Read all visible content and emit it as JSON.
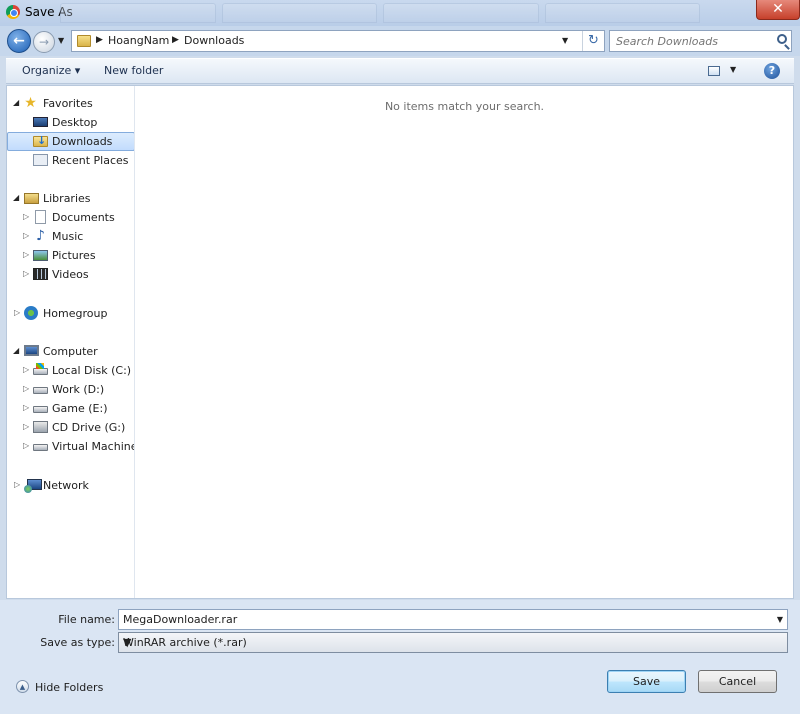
{
  "window": {
    "title": "Save As",
    "close_glyph": "✕"
  },
  "nav": {
    "back_glyph": "←",
    "forward_glyph": "→",
    "breadcrumbs": [
      "HoangNam",
      "Downloads"
    ],
    "refresh_glyph": "↻"
  },
  "search": {
    "placeholder": "Search Downloads"
  },
  "toolbar": {
    "organize_label": "Organize ▾",
    "new_folder_label": "New folder",
    "help_glyph": "?"
  },
  "navpane": {
    "favorites": {
      "label": "Favorites",
      "items": [
        {
          "label": "Desktop",
          "icon": "desktop-icon"
        },
        {
          "label": "Downloads",
          "icon": "downloads-folder-icon",
          "selected": true
        },
        {
          "label": "Recent Places",
          "icon": "recent-places-icon"
        }
      ]
    },
    "libraries": {
      "label": "Libraries",
      "items": [
        {
          "label": "Documents",
          "icon": "documents-icon"
        },
        {
          "label": "Music",
          "icon": "music-icon"
        },
        {
          "label": "Pictures",
          "icon": "pictures-icon"
        },
        {
          "label": "Videos",
          "icon": "videos-icon"
        }
      ]
    },
    "homegroup": {
      "label": "Homegroup"
    },
    "computer": {
      "label": "Computer",
      "items": [
        {
          "label": "Local Disk (C:)",
          "icon": "system-disk-icon"
        },
        {
          "label": "Work (D:)",
          "icon": "disk-icon"
        },
        {
          "label": "Game (E:)",
          "icon": "disk-icon"
        },
        {
          "label": "CD Drive (G:)",
          "icon": "cd-drive-icon"
        },
        {
          "label": "Virtual Machine (",
          "icon": "disk-icon"
        }
      ]
    },
    "network": {
      "label": "Network"
    }
  },
  "content": {
    "empty_message": "No items match your search."
  },
  "form": {
    "file_name_label": "File name:",
    "file_name_value": "MegaDownloader.rar",
    "save_type_label": "Save as type:",
    "save_type_value": "WinRAR archive (*.rar)"
  },
  "footer": {
    "hide_folders_label": "Hide Folders",
    "save_label": "Save",
    "cancel_label": "Cancel"
  }
}
